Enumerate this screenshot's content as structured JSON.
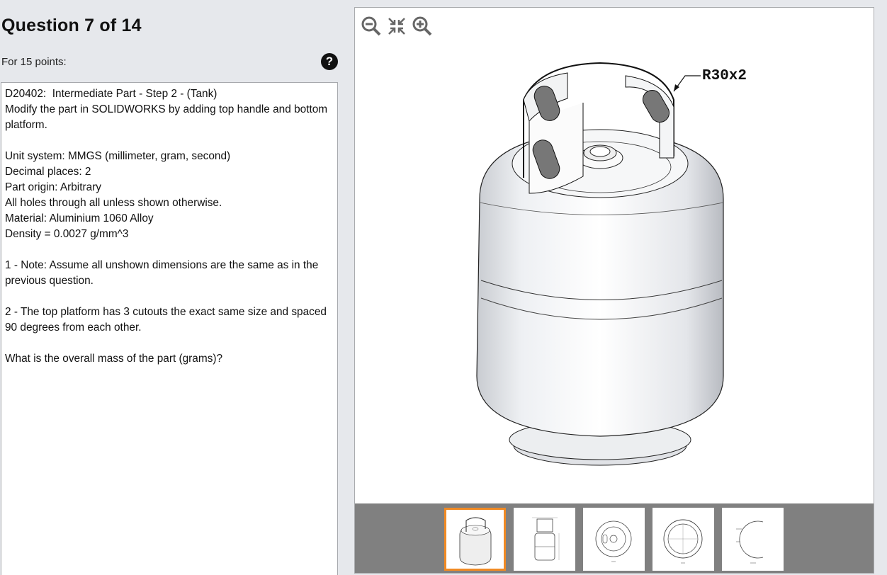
{
  "question": {
    "title": "Question 7 of 14",
    "points": "For 15 points:",
    "help_symbol": "?",
    "body": [
      "D20402:  Intermediate Part - Step 2 - (Tank)",
      "Modify the part in SOLIDWORKS by adding top handle and bottom platform.",
      "",
      "Unit system: MMGS (millimeter, gram, second)",
      "Decimal places: 2",
      "Part origin: Arbitrary",
      "All holes through all unless shown otherwise.",
      "Material: Aluminium 1060 Alloy",
      "Density = 0.0027 g/mm^3",
      "",
      "1 - Note: Assume all unshown dimensions are the same as in the previous question.",
      "",
      "2 - The top platform has 3 cutouts the exact same size and spaced 90 degrees from each other.",
      "",
      "What is the overall mass of the part (grams)?"
    ]
  },
  "viewer": {
    "callout_label": "R30x2",
    "zoom_controls": [
      "zoom-out-icon",
      "fit-to-screen-icon",
      "zoom-in-icon"
    ],
    "thumbnails": [
      {
        "name": "isometric-view",
        "active": true
      },
      {
        "name": "front-view",
        "active": false
      },
      {
        "name": "top-view",
        "active": false
      },
      {
        "name": "bottom-view",
        "active": false
      },
      {
        "name": "detail-view",
        "active": false
      }
    ],
    "accent_color": "#f08a24"
  }
}
